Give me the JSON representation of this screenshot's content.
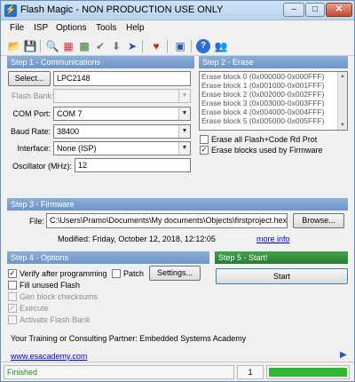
{
  "window": {
    "title": "Flash Magic - NON PRODUCTION USE ONLY"
  },
  "menu": [
    "File",
    "ISP",
    "Options",
    "Tools",
    "Help"
  ],
  "toolbar": {
    "icons": [
      "save-icon",
      "open-icon",
      "search-icon",
      "erase-icon",
      "program-icon",
      "check-icon",
      "download-icon",
      "run-icon",
      "heart-icon",
      "screen-icon",
      "help-icon",
      "users-icon"
    ]
  },
  "step1": {
    "header": "Step 1 - Communications",
    "select_label": "Select...",
    "device": "LPC2148",
    "flash_bank_label": "Flash Bank:",
    "com_port_label": "COM Port:",
    "com_port": "COM 7",
    "baud_rate_label": "Baud Rate:",
    "baud_rate": "38400",
    "interface_label": "Interface:",
    "interface": "None (ISP)",
    "oscillator_label": "Oscillator (MHz):",
    "oscillator": "12"
  },
  "step2": {
    "header": "Step 2 - Erase",
    "blocks": [
      "Erase block 0 (0x000000-0x000FFF)",
      "Erase block 1 (0x001000-0x001FFF)",
      "Erase block 2 (0x002000-0x002FFF)",
      "Erase block 3 (0x003000-0x003FFF)",
      "Erase block 4 (0x004000-0x004FFF)",
      "Erase block 5 (0x005000-0x005FFF)"
    ],
    "erase_all_label": "Erase all Flash+Code Rd Prot",
    "erase_used_label": "Erase blocks used by Firmware"
  },
  "step3": {
    "header": "Step 3 - Firmware",
    "file_label": "File:",
    "file_path": "C:\\Users\\Pramo\\Documents\\My documents\\Objects\\firstproject.hex",
    "browse_label": "Browse...",
    "modified": "Modified: Friday, October 12, 2018, 12:12:05",
    "more_info": "more info"
  },
  "step4": {
    "header": "Step 4 - Options",
    "verify_label": "Verify after programming",
    "patch_label": "Patch",
    "settings_label": "Settings...",
    "fill_label": "Fill unused Flash",
    "gen_label": "Gen block checksums",
    "execute_label": "Execute",
    "activate_label": "Activate Flash Bank"
  },
  "step5": {
    "header": "Step 5 - Start!",
    "start_label": "Start"
  },
  "partner": {
    "text": "Your Training or Consulting Partner: Embedded Systems Academy",
    "url": "www.esacademy.com"
  },
  "status": {
    "text": "Finished",
    "count": "1",
    "progress": 1.0,
    "accent": "#2eb82e"
  }
}
